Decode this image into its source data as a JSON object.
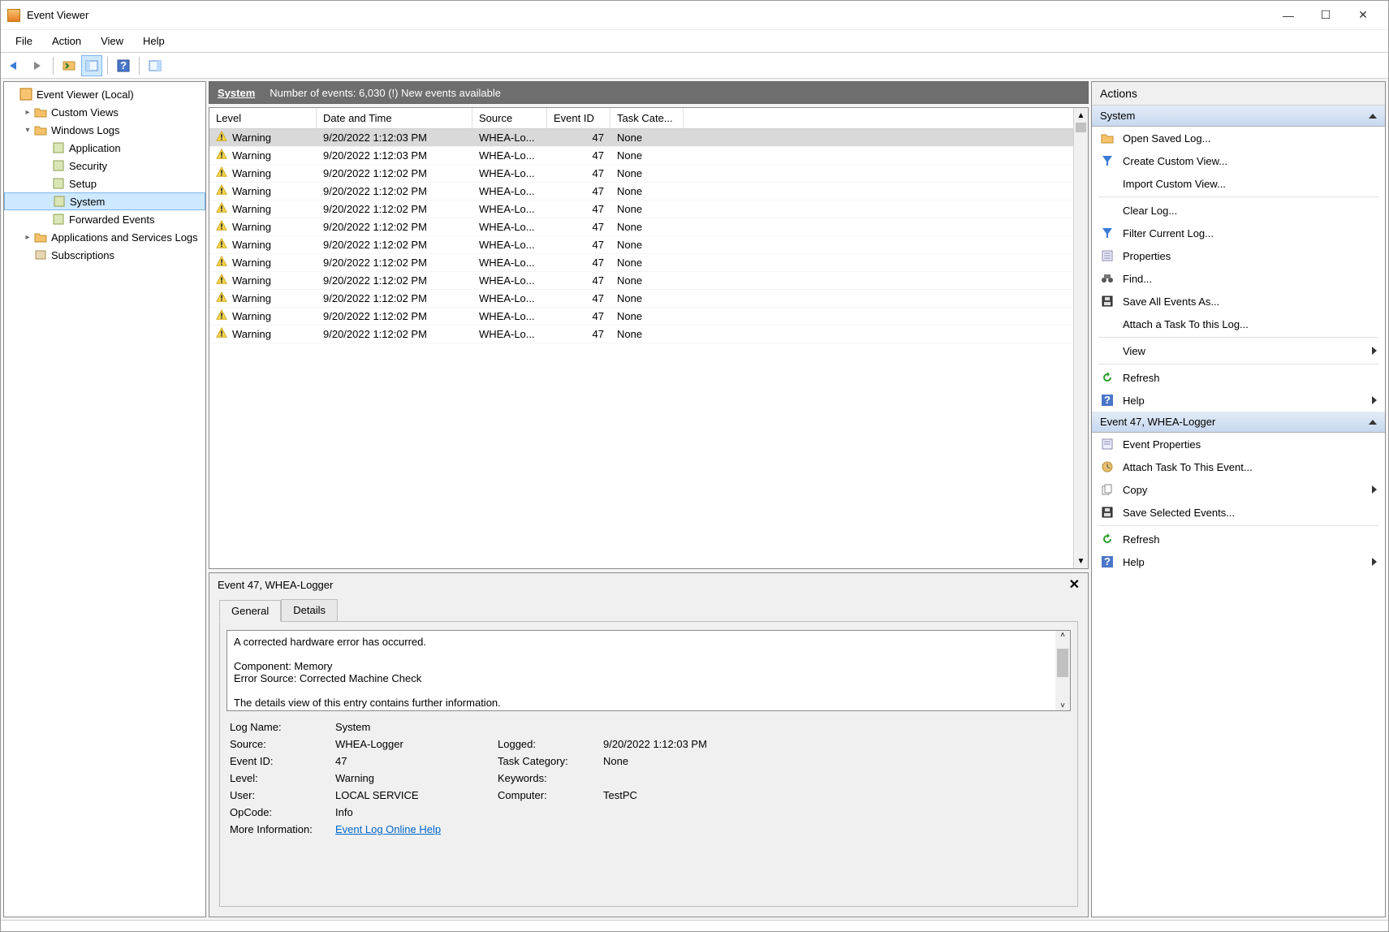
{
  "window": {
    "title": "Event Viewer"
  },
  "menu": {
    "file": "File",
    "action": "Action",
    "view": "View",
    "help": "Help"
  },
  "tree": {
    "root": "Event Viewer (Local)",
    "custom_views": "Custom Views",
    "windows_logs": "Windows Logs",
    "application": "Application",
    "security": "Security",
    "setup": "Setup",
    "system": "System",
    "forwarded": "Forwarded Events",
    "apps_svc": "Applications and Services Logs",
    "subscriptions": "Subscriptions"
  },
  "log_header": {
    "name": "System",
    "summary": "Number of events: 6,030 (!) New events available"
  },
  "columns": {
    "level": "Level",
    "date": "Date and Time",
    "source": "Source",
    "eventid": "Event ID",
    "task": "Task Cate..."
  },
  "events": [
    {
      "level": "Warning",
      "date": "9/20/2022 1:12:03 PM",
      "source": "WHEA-Lo...",
      "id": "47",
      "task": "None"
    },
    {
      "level": "Warning",
      "date": "9/20/2022 1:12:03 PM",
      "source": "WHEA-Lo...",
      "id": "47",
      "task": "None"
    },
    {
      "level": "Warning",
      "date": "9/20/2022 1:12:02 PM",
      "source": "WHEA-Lo...",
      "id": "47",
      "task": "None"
    },
    {
      "level": "Warning",
      "date": "9/20/2022 1:12:02 PM",
      "source": "WHEA-Lo...",
      "id": "47",
      "task": "None"
    },
    {
      "level": "Warning",
      "date": "9/20/2022 1:12:02 PM",
      "source": "WHEA-Lo...",
      "id": "47",
      "task": "None"
    },
    {
      "level": "Warning",
      "date": "9/20/2022 1:12:02 PM",
      "source": "WHEA-Lo...",
      "id": "47",
      "task": "None"
    },
    {
      "level": "Warning",
      "date": "9/20/2022 1:12:02 PM",
      "source": "WHEA-Lo...",
      "id": "47",
      "task": "None"
    },
    {
      "level": "Warning",
      "date": "9/20/2022 1:12:02 PM",
      "source": "WHEA-Lo...",
      "id": "47",
      "task": "None"
    },
    {
      "level": "Warning",
      "date": "9/20/2022 1:12:02 PM",
      "source": "WHEA-Lo...",
      "id": "47",
      "task": "None"
    },
    {
      "level": "Warning",
      "date": "9/20/2022 1:12:02 PM",
      "source": "WHEA-Lo...",
      "id": "47",
      "task": "None"
    },
    {
      "level": "Warning",
      "date": "9/20/2022 1:12:02 PM",
      "source": "WHEA-Lo...",
      "id": "47",
      "task": "None"
    },
    {
      "level": "Warning",
      "date": "9/20/2022 1:12:02 PM",
      "source": "WHEA-Lo...",
      "id": "47",
      "task": "None"
    }
  ],
  "detail": {
    "title": "Event 47, WHEA-Logger",
    "tab_general": "General",
    "tab_details": "Details",
    "description": "A corrected hardware error has occurred.\n\nComponent: Memory\nError Source: Corrected Machine Check\n\nThe details view of this entry contains further information.",
    "labels": {
      "logname": "Log Name:",
      "source": "Source:",
      "eventid": "Event ID:",
      "level": "Level:",
      "user": "User:",
      "opcode": "OpCode:",
      "moreinfo": "More Information:",
      "logged": "Logged:",
      "taskcat": "Task Category:",
      "keywords": "Keywords:",
      "computer": "Computer:"
    },
    "values": {
      "logname": "System",
      "source": "WHEA-Logger",
      "eventid": "47",
      "level": "Warning",
      "user": "LOCAL SERVICE",
      "opcode": "Info",
      "help_link": "Event Log Online Help",
      "logged": "9/20/2022 1:12:03 PM",
      "taskcat": "None",
      "keywords": "",
      "computer": "TestPC"
    }
  },
  "actions": {
    "header": "Actions",
    "section1": "System",
    "open_saved": "Open Saved Log...",
    "create_view": "Create Custom View...",
    "import_view": "Import Custom View...",
    "clear_log": "Clear Log...",
    "filter_log": "Filter Current Log...",
    "properties": "Properties",
    "find": "Find...",
    "save_all": "Save All Events As...",
    "attach_log": "Attach a Task To this Log...",
    "view": "View",
    "refresh": "Refresh",
    "help": "Help",
    "section2": "Event 47, WHEA-Logger",
    "event_props": "Event Properties",
    "attach_event": "Attach Task To This Event...",
    "copy": "Copy",
    "save_sel": "Save Selected Events...",
    "refresh2": "Refresh",
    "help2": "Help"
  }
}
